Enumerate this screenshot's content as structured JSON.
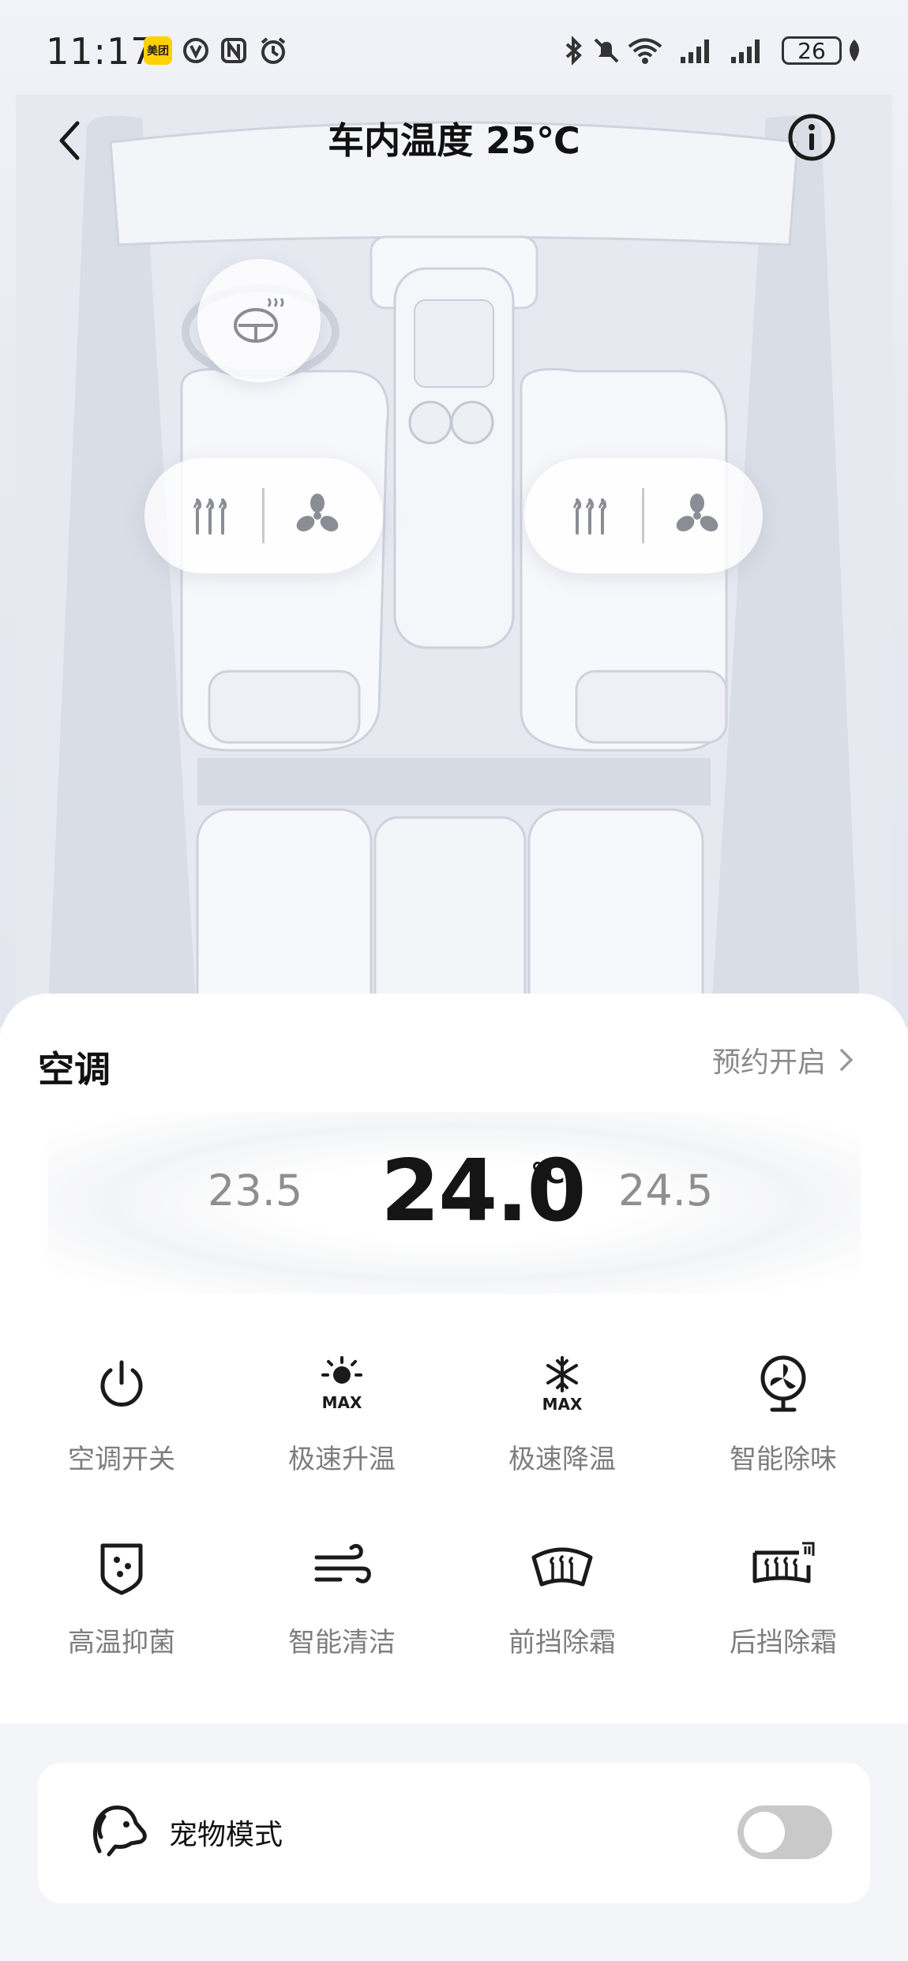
{
  "status_bar": {
    "time": "11:17",
    "app_badge": "美团",
    "battery": "26"
  },
  "header": {
    "title": "车内温度 25℃"
  },
  "climate": {
    "section_title": "空调",
    "schedule_label": "预约开启",
    "temp_prev": "23.5",
    "temp_current": "24.0",
    "temp_unit": "℃",
    "temp_next": "24.5"
  },
  "controls": [
    {
      "label": "空调开关",
      "icon": "power-icon"
    },
    {
      "label": "极速升温",
      "icon": "sun-max-icon"
    },
    {
      "label": "极速降温",
      "icon": "snowflake-max-icon"
    },
    {
      "label": "智能除味",
      "icon": "fan-purify-icon"
    },
    {
      "label": "高温抑菌",
      "icon": "shield-dots-icon"
    },
    {
      "label": "智能清洁",
      "icon": "wind-icon"
    },
    {
      "label": "前挡除霜",
      "icon": "front-defrost-icon"
    },
    {
      "label": "后挡除霜",
      "icon": "rear-defrost-icon"
    }
  ],
  "pet_mode": {
    "label": "宠物模式",
    "enabled": false,
    "icon": "dog-icon"
  },
  "colors": {
    "accent": "#151515",
    "muted": "#8a8a8a",
    "toggle_off": "#c9c9c9"
  }
}
